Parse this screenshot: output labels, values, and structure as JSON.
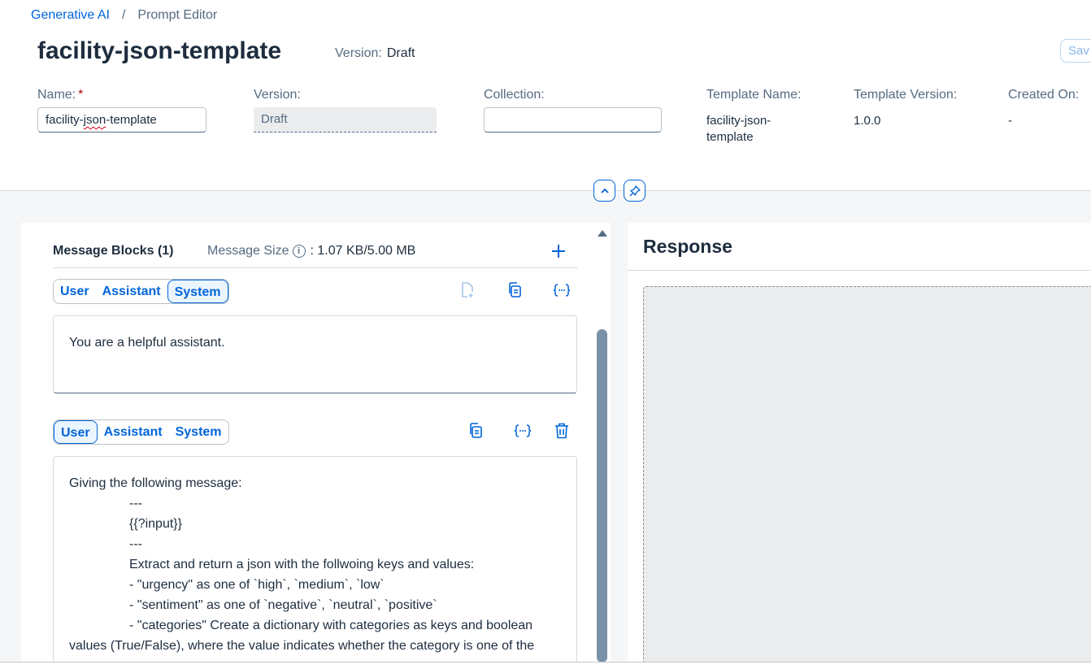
{
  "breadcrumb": {
    "root": "Generative AI",
    "separator": "/",
    "current": "Prompt Editor"
  },
  "page": {
    "title": "facility-json-template",
    "version_label": "Version:",
    "version_value": "Draft",
    "save_label": "Sav"
  },
  "form": {
    "name_label": "Name:",
    "name_required": "*",
    "name_value": "facility-json-template",
    "version_label": "Version:",
    "version_value": "Draft",
    "collection_label": "Collection:",
    "collection_value": "",
    "template_name_label": "Template Name:",
    "template_name_value": "facility-json-template",
    "template_version_label": "Template Version:",
    "template_version_value": "1.0.0",
    "created_on_label": "Created On:",
    "created_on_value": "-"
  },
  "message_blocks": {
    "title": "Message Blocks (1)",
    "size_label": "Message Size",
    "size_value": ": 1.07 KB/5.00 MB",
    "roles": [
      "User",
      "Assistant",
      "System"
    ],
    "block1": {
      "active_role": "System",
      "text": "You are a helpful assistant."
    },
    "block2": {
      "active_role": "User",
      "lines": [
        "Giving the following message:",
        "---",
        "{{?input}}",
        "---",
        "Extract and return a json with the follwoing keys and values:",
        "- \"urgency\" as one of `high`, `medium`, `low`",
        "- \"sentiment\" as one of `negative`, `neutral`, `positive`",
        "- \"categories\" Create a dictionary with categories as keys and boolean",
        "values (True/False), where the value indicates whether the category is one of the"
      ]
    }
  },
  "response": {
    "title": "Response"
  }
}
